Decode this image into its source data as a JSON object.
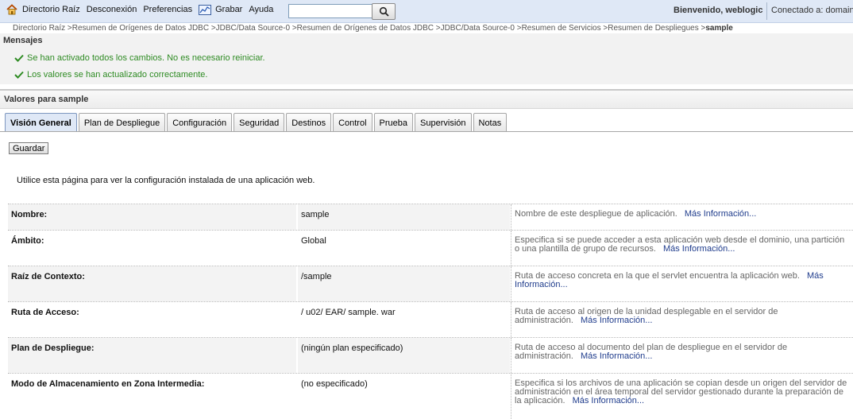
{
  "topbar": {
    "nav": [
      {
        "label": "Directorio Raíz",
        "icon": "home-icon"
      },
      {
        "label": "Desconexión"
      },
      {
        "label": "Preferencias"
      },
      {
        "label": "Grabar",
        "icon": "record-chart-icon"
      },
      {
        "label": "Ayuda"
      }
    ],
    "search_value": "",
    "welcome": "Bienvenido, weblogic",
    "connected": "Conectado a: domain"
  },
  "breadcrumb": {
    "path": "Directorio Raíz >Resumen de Orígenes de Datos JDBC >JDBC/Data Source-0 >Resumen de Orígenes de Datos JDBC >JDBC/Data Source-0 >Resumen de Servicios >Resumen de Despliegues >",
    "current": "sample"
  },
  "messages": {
    "title": "Mensajes",
    "items": [
      "Se han activado todos los cambios. No es necesario reiniciar.",
      "Los valores se han actualizado correctamente."
    ],
    "color": "#2e8b23"
  },
  "section_title": "Valores para sample",
  "tabs": [
    "Visión General",
    "Plan de Despliegue",
    "Configuración",
    "Seguridad",
    "Destinos",
    "Control",
    "Prueba",
    "Supervisión",
    "Notas"
  ],
  "active_tab": "Visión General",
  "save_label": "Guardar",
  "intro": "Utilice esta página para ver la configuración instalada de una aplicación web.",
  "more_info_label": "Más Información...",
  "rows": [
    {
      "label": "Nombre:",
      "value": "sample",
      "desc": "Nombre de este despliegue de aplicación."
    },
    {
      "label": "Ámbito:",
      "value": "Global",
      "desc": "Especifica si se puede acceder a esta aplicación web desde el dominio, una partición o una plantilla de grupo de recursos."
    },
    {
      "label": "Raíz de Contexto:",
      "value": "/sample",
      "desc": "Ruta de acceso concreta en la que el servlet encuentra la aplicación web."
    },
    {
      "label": "Ruta de Acceso:",
      "value": "/ u02/ EAR/ sample. war",
      "desc": "Ruta de acceso al origen de la unidad desplegable en el servidor de administración."
    },
    {
      "label": "Plan de Despliegue:",
      "value": "(ningún plan especificado)",
      "desc": "Ruta de acceso al documento del plan de despliegue en el servidor de administración."
    },
    {
      "label": "Modo de Almacenamiento en Zona Intermedia:",
      "value": "(no especificado)",
      "desc": "Especifica si los archivos de una aplicación se copian desde un origen del servidor de administración en el área temporal del servidor gestionado durante la preparación de la aplicación."
    }
  ]
}
